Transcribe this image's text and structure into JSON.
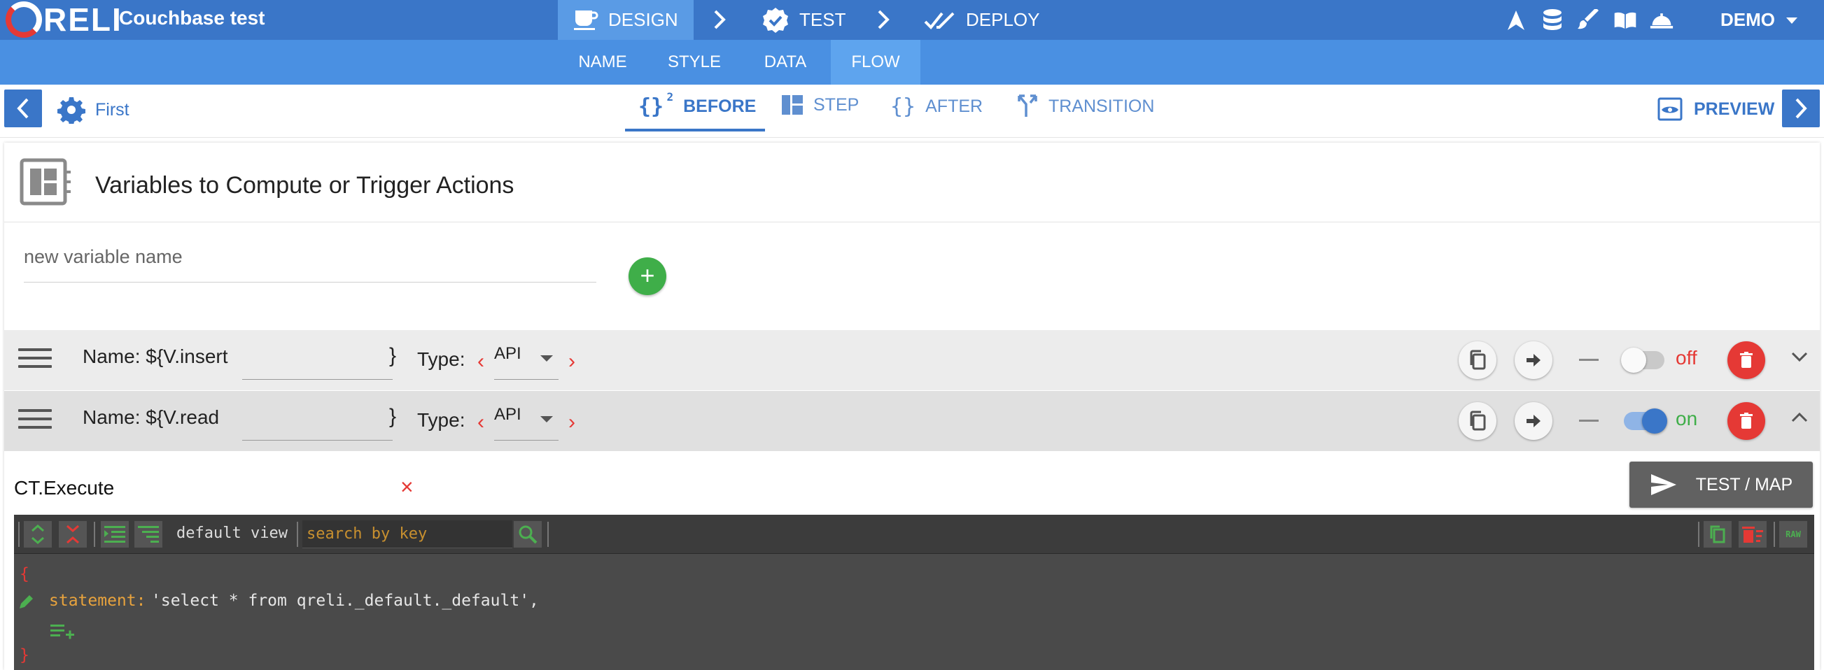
{
  "topbar": {
    "logo_text": "RELI",
    "app_title": "Couchbase test",
    "stages": [
      {
        "label": "DESIGN",
        "active": true
      },
      {
        "label": "TEST",
        "active": false
      },
      {
        "label": "DEPLOY",
        "active": false
      }
    ],
    "icons": [
      "navigate-icon",
      "database-icon",
      "brush-icon",
      "book-icon",
      "service-bell-icon"
    ],
    "user": "DEMO"
  },
  "subtabs": [
    {
      "label": "NAME"
    },
    {
      "label": "STYLE"
    },
    {
      "label": "DATA"
    },
    {
      "label": "FLOW",
      "active": true
    }
  ],
  "stepbar": {
    "step_name": "First",
    "tabs": [
      {
        "label": "BEFORE",
        "superscript": "2",
        "active": true
      },
      {
        "label": "STEP"
      },
      {
        "label": "AFTER"
      },
      {
        "label": "TRANSITION"
      }
    ],
    "preview_label": "PREVIEW"
  },
  "card": {
    "title": "Variables to Compute or Trigger Actions",
    "new_variable_placeholder": "new variable name",
    "add_label": "+"
  },
  "variables": [
    {
      "name_prefix": "Name: ${",
      "name": "V.insert",
      "brace": "}",
      "type_label": "Type:",
      "type": "API",
      "toggle_label": "off",
      "enabled": false,
      "expanded": false
    },
    {
      "name_prefix": "Name: ${",
      "name": "V.read",
      "brace": "}",
      "type_label": "Type:",
      "type": "API",
      "toggle_label": "on",
      "enabled": true,
      "expanded": true
    }
  ],
  "execute": {
    "label": "CT.Execute",
    "clear_label": "×",
    "test_map_label": "TEST / MAP"
  },
  "editor": {
    "view_mode": "default view",
    "search_placeholder": "search by key",
    "raw_label": "RAW",
    "open_brace": "{",
    "key": "statement:",
    "value": "'select * from qreli._default._default',",
    "close_brace": "}"
  },
  "colors": {
    "primary": "#3a76c8",
    "subbar": "#4a90e2",
    "success": "#3fae49",
    "danger": "#e53935",
    "editor_bg": "#4a4a4a"
  }
}
